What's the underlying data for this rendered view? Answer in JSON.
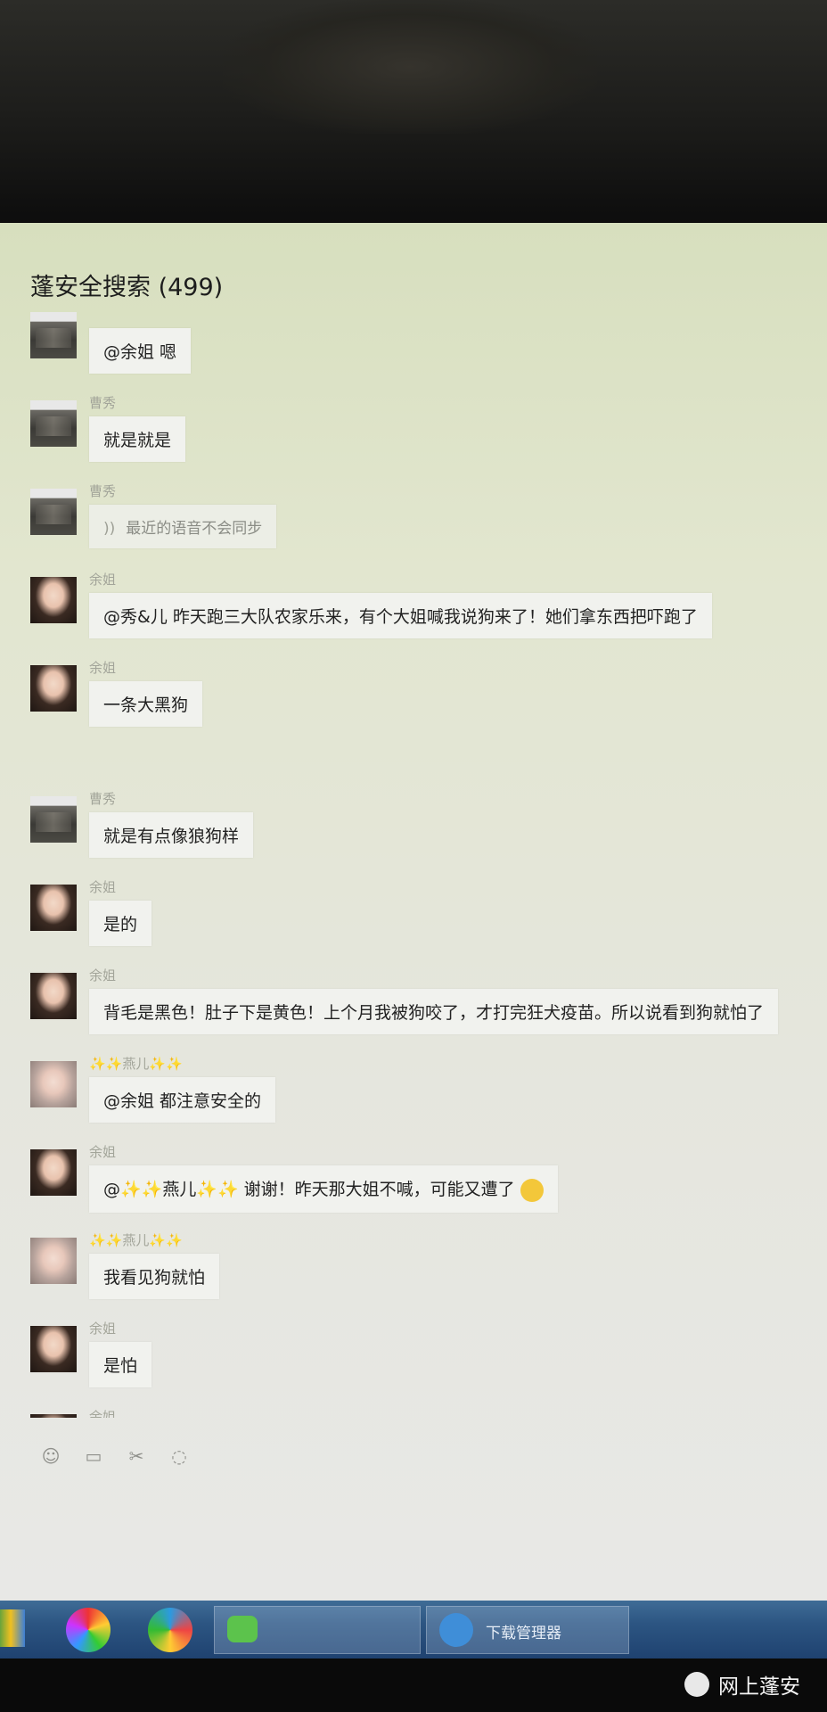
{
  "chat": {
    "title": "蓬安全搜索 (499)",
    "messages": [
      {
        "sender": "",
        "text": "@余姐 嗯",
        "avatar": "shop"
      },
      {
        "sender": "曹秀",
        "text": "就是就是",
        "avatar": "shop"
      },
      {
        "sender": "曹秀",
        "text": "最近的语音不会同步",
        "avatar": "shop",
        "voice": true
      },
      {
        "sender": "余姐",
        "text": "@秀&儿 昨天跑三大队农家乐来，有个大姐喊我说狗来了！她们拿东西把吓跑了",
        "avatar": "woman"
      },
      {
        "sender": "余姐",
        "text": "一条大黑狗",
        "avatar": "woman"
      },
      {
        "sender": "曹秀",
        "text": "就是有点像狼狗样",
        "avatar": "shop",
        "gap": true
      },
      {
        "sender": "余姐",
        "text": "是的",
        "avatar": "woman"
      },
      {
        "sender": "余姐",
        "text": "背毛是黑色！肚子下是黄色！上个月我被狗咬了，才打完狂犬疫苗。所以说看到狗就怕了",
        "avatar": "woman"
      },
      {
        "sender": "✨✨燕儿✨✨",
        "text": "@余姐 都注意安全的",
        "avatar": "woman2"
      },
      {
        "sender": "余姐",
        "text": "@✨✨燕儿✨✨ 谢谢！昨天那大姐不喊，可能又遭了",
        "avatar": "woman",
        "emoji": true
      },
      {
        "sender": "✨✨燕儿✨✨",
        "text": "我看见狗就怕",
        "avatar": "woman2"
      },
      {
        "sender": "余姐",
        "text": "是怕",
        "avatar": "woman"
      },
      {
        "sender": "余姐",
        "text": "",
        "avatar": "woman"
      }
    ]
  },
  "toolbar": {
    "icons": [
      "emoji-icon",
      "folder-icon",
      "scissors-icon",
      "chat-history-icon"
    ],
    "glyphs": [
      "☺",
      "▭",
      "✂",
      "◌"
    ]
  },
  "taskbar": {
    "download_label": "下载管理器"
  },
  "watermark": {
    "text": "网上蓬安"
  },
  "colors": {
    "screen_bg": "#e4e6d6",
    "bubble_bg": "#f1f2ee",
    "taskbar": "#2c5582"
  }
}
